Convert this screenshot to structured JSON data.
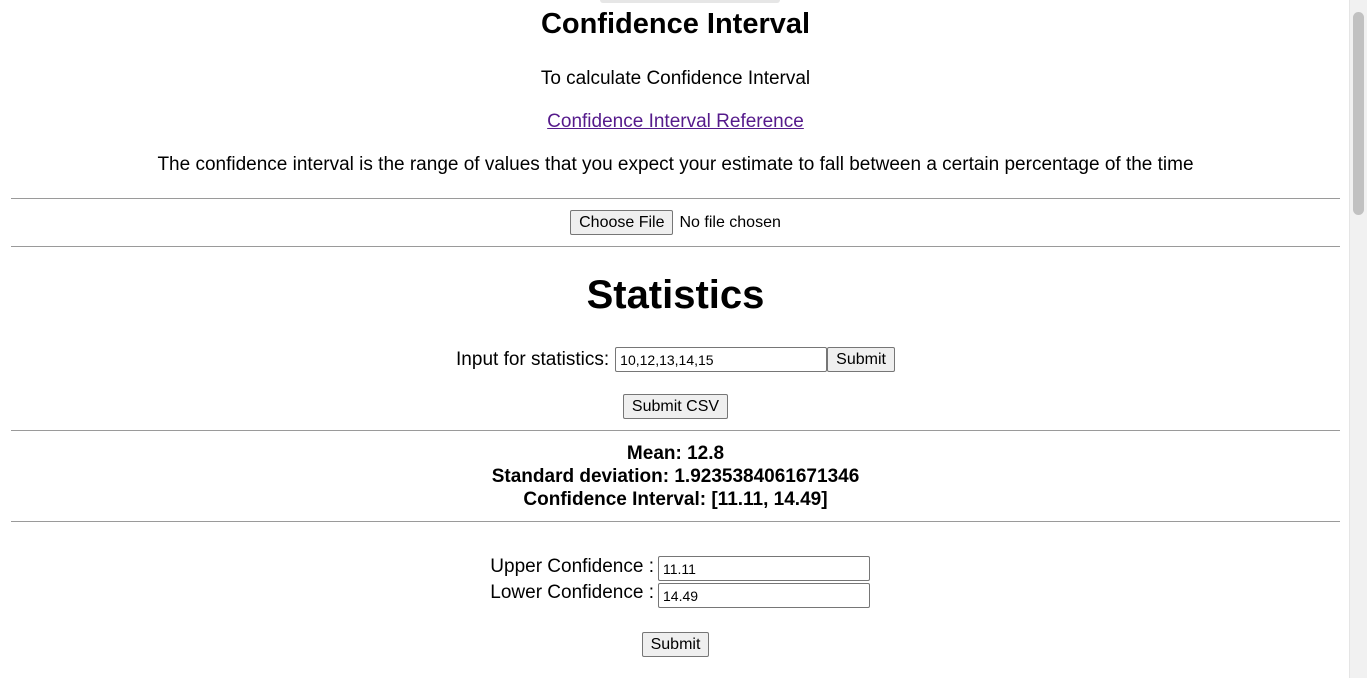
{
  "header": {
    "title": "Confidence Interval",
    "subtitle": "To calculate Confidence Interval",
    "reference_link": "Confidence Interval Reference",
    "description": "The confidence interval is the range of values that you expect your estimate to fall between a certain percentage of the time"
  },
  "file_upload": {
    "button_label": "Choose File",
    "status": "No file chosen"
  },
  "statistics": {
    "title": "Statistics",
    "input_label": "Input for statistics:",
    "input_value": "10,12,13,14,15",
    "submit_label": "Submit",
    "submit_csv_label": "Submit CSV"
  },
  "results": {
    "mean": "Mean: 12.8",
    "std_dev": "Standard deviation: 1.9235384061671346",
    "confidence_interval": "Confidence Interval: [11.11, 14.49]"
  },
  "confidence_form": {
    "upper_label": "Upper Confidence :",
    "upper_value": "11.11",
    "lower_label": "Lower Confidence :",
    "lower_value": "14.49",
    "submit_label": "Submit"
  }
}
